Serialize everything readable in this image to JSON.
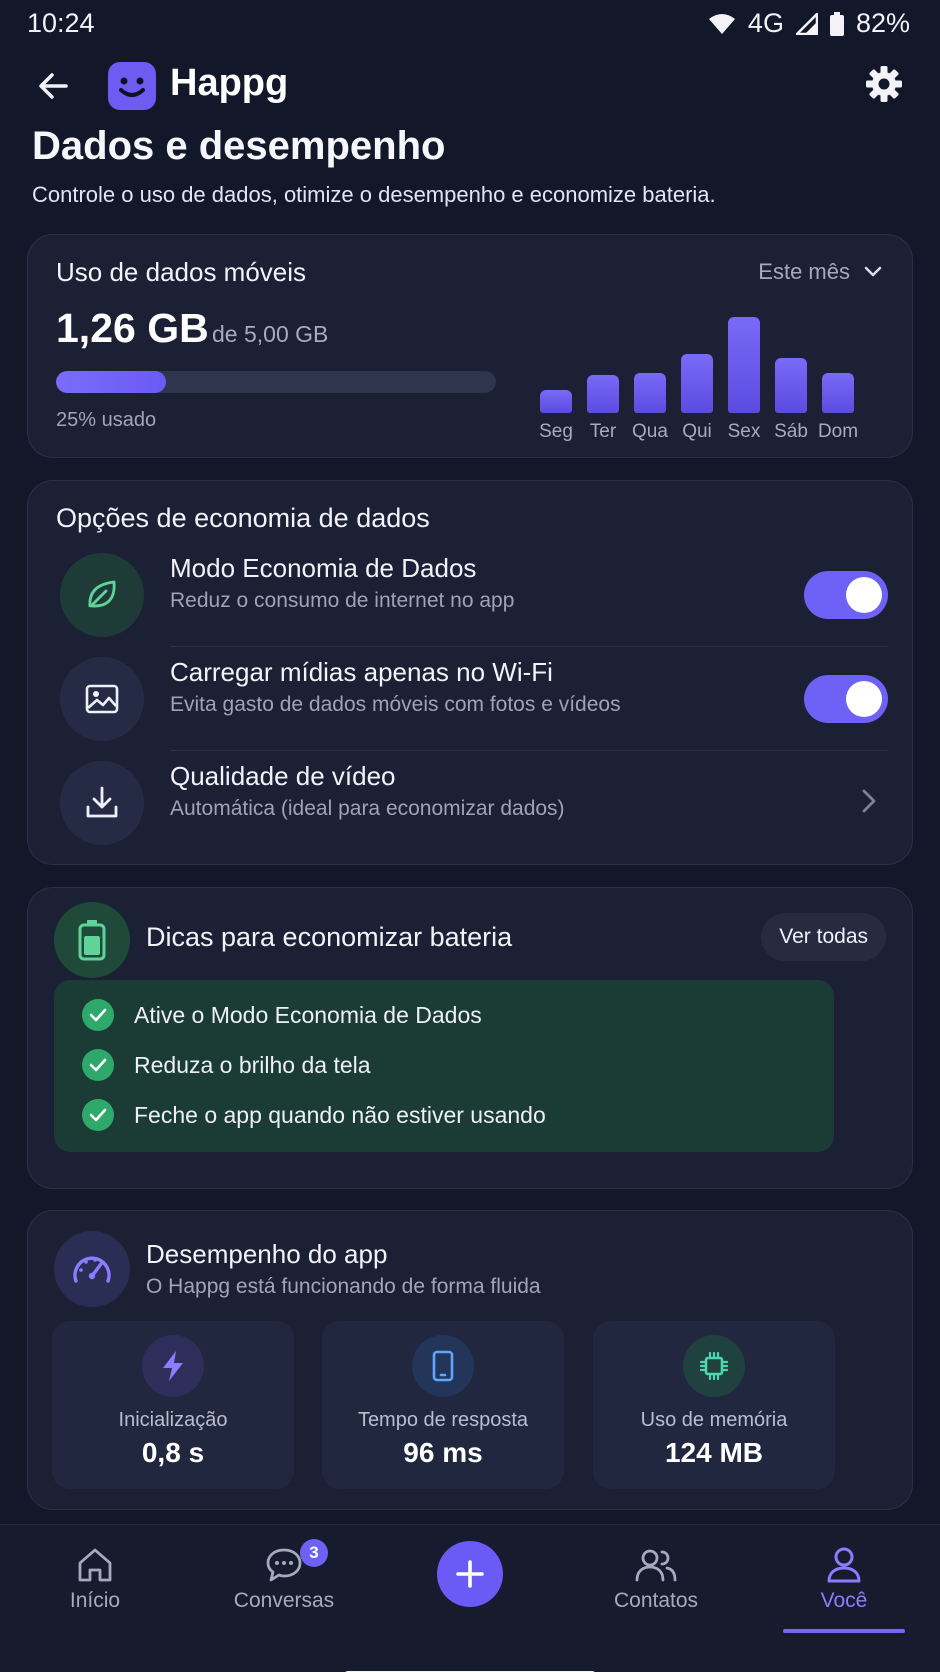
{
  "status_bar": {
    "time": "10:24",
    "network": "4G",
    "battery": "82%"
  },
  "app_bar": {
    "brand": "Happg",
    "icons": [
      "back-arrow-icon",
      "smiley-logo-icon",
      "gear-icon"
    ]
  },
  "page": {
    "title": "Dados e desempenho",
    "subtitle": "Controle o uso de dados, otimize o desempenho e economize bateria."
  },
  "data_usage": {
    "title": "Uso de dados móveis",
    "period": "Este mês",
    "used": "1,26 GB",
    "total": "de 5,00 GB",
    "percent_used": 25,
    "percent_label": "25% usado",
    "accent": "#6e61f5"
  },
  "chart_data": {
    "type": "bar",
    "categories": [
      "Seg",
      "Ter",
      "Qua",
      "Qui",
      "Sex",
      "Sáb",
      "Dom"
    ],
    "values": [
      18,
      30,
      32,
      47,
      77,
      44,
      32
    ],
    "ylim": [
      0,
      80
    ],
    "grid": false,
    "color": "#6e61f5"
  },
  "economy": {
    "title": "Opções de economia de dados",
    "options": [
      {
        "icon": "leaf-icon",
        "title": "Modo Economia de Dados",
        "description": "Reduz o consumo de internet no app",
        "control": "toggle",
        "enabled": true
      },
      {
        "icon": "image-icon",
        "title": "Carregar mídias apenas no Wi-Fi",
        "description": "Evita gasto de dados móveis com fotos e vídeos",
        "control": "toggle",
        "enabled": true
      },
      {
        "icon": "download-icon",
        "title": "Qualidade de vídeo",
        "description": "Automática (ideal para economizar dados)",
        "control": "chevron"
      }
    ]
  },
  "battery": {
    "title": "Dicas para economizar bateria",
    "view_all": "Ver todas",
    "tips": [
      "Ative o Modo Economia de Dados",
      "Reduza o brilho da tela",
      "Feche o app quando não estiver usando"
    ],
    "accent": "#2fa96b"
  },
  "performance": {
    "title": "Desempenho do app",
    "subtitle": "O Happg está funcionando de forma fluida",
    "metrics": [
      {
        "icon": "lightning-icon",
        "label": "Inicialização",
        "value": "0,8 s"
      },
      {
        "icon": "phone-icon",
        "label": "Tempo de resposta",
        "value": "96 ms"
      },
      {
        "icon": "chip-icon",
        "label": "Uso de memória",
        "value": "124 MB"
      }
    ]
  },
  "bottom_nav": {
    "items": [
      {
        "icon": "home-icon",
        "label": "Início"
      },
      {
        "icon": "chat-icon",
        "label": "Conversas",
        "badge": "3"
      },
      {
        "icon": "plus-icon",
        "label": ""
      },
      {
        "icon": "contacts-icon",
        "label": "Contatos"
      },
      {
        "icon": "profile-icon",
        "label": "Você",
        "active": true
      }
    ]
  }
}
